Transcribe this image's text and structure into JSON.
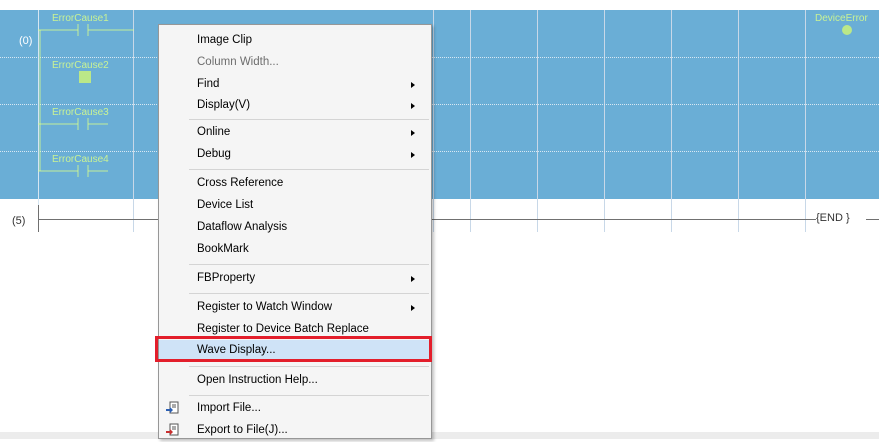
{
  "ladder": {
    "step_0": "(0)",
    "step_5": "(5)",
    "contacts": [
      "ErrorCause1",
      "ErrorCause2",
      "ErrorCause3",
      "ErrorCause4"
    ],
    "coil_label": "DeviceError",
    "end_label": "{END }"
  },
  "menu": {
    "items": [
      {
        "label": "Image Clip",
        "disabled": false,
        "submenu": false
      },
      {
        "label": "Column Width...",
        "disabled": true,
        "submenu": false
      },
      {
        "label": "Find",
        "disabled": false,
        "submenu": true
      },
      {
        "label": "Display(V)",
        "disabled": false,
        "submenu": true
      },
      {
        "label": "Online",
        "disabled": false,
        "submenu": true
      },
      {
        "label": "Debug",
        "disabled": false,
        "submenu": true
      },
      {
        "label": "Cross Reference",
        "disabled": false,
        "submenu": false
      },
      {
        "label": "Device List",
        "disabled": false,
        "submenu": false
      },
      {
        "label": "Dataflow Analysis",
        "disabled": false,
        "submenu": false
      },
      {
        "label": "BookMark",
        "disabled": false,
        "submenu": false
      },
      {
        "label": "FBProperty",
        "disabled": false,
        "submenu": true
      },
      {
        "label": "Register to Watch Window",
        "disabled": false,
        "submenu": true
      },
      {
        "label": "Register to Device Batch Replace",
        "disabled": false,
        "submenu": false
      },
      {
        "label": "Wave Display...",
        "disabled": false,
        "submenu": false,
        "highlighted": true
      },
      {
        "label": "Open Instruction Help...",
        "disabled": false,
        "submenu": false
      },
      {
        "label": "Import File...",
        "disabled": false,
        "submenu": false,
        "icon": "import-file-icon"
      },
      {
        "label": "Export to File(J)...",
        "disabled": false,
        "submenu": false,
        "icon": "export-file-icon"
      }
    ]
  },
  "colors": {
    "selection_band": "#6aaed6",
    "highlight_frame": "#e31e2b",
    "menu_bg": "#f5f5f5"
  }
}
